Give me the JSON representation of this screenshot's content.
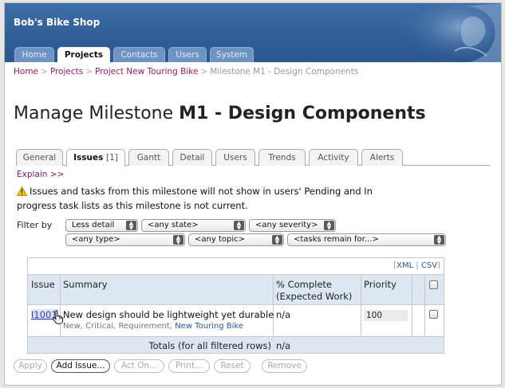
{
  "header": {
    "brand": "Bob's Bike Shop",
    "tabs": [
      {
        "label": "Home",
        "active": false
      },
      {
        "label": "Projects",
        "active": true
      },
      {
        "label": "Contacts",
        "active": false
      },
      {
        "label": "Users",
        "active": false
      },
      {
        "label": "System",
        "active": false
      }
    ]
  },
  "breadcrumb": {
    "items": [
      "Home",
      "Projects",
      "Project New Touring Bike"
    ],
    "current": "Milestone M1 - Design Components",
    "separator": ">"
  },
  "title": {
    "prefix": "Manage Milestone",
    "name": "M1 - Design Components"
  },
  "subtabs": [
    {
      "label": "General",
      "active": false
    },
    {
      "label": "Issues",
      "count": "[1]",
      "active": true
    },
    {
      "label": "Gantt",
      "active": false
    },
    {
      "label": "Detail",
      "active": false
    },
    {
      "label": "Users",
      "active": false
    },
    {
      "label": "Trends",
      "active": false
    },
    {
      "label": "Activity",
      "active": false
    },
    {
      "label": "Alerts",
      "active": false
    }
  ],
  "explain_link": "Explain >>",
  "warning": {
    "line1": "Issues and tasks from this milestone will not show in users' Pending and In",
    "line2": "progress task lists as this milestone is not current."
  },
  "filter": {
    "label": "Filter by",
    "detail": "Less detail",
    "state": "<any state>",
    "severity": "<any severity>",
    "type": "<any type>",
    "topic": "<any topic>",
    "tasks": "<tasks remain for...>"
  },
  "table": {
    "links": {
      "xml": "XML",
      "sep": "|",
      "csv": "CSV",
      "open": "[",
      "close": "]"
    },
    "columns": {
      "issue": "Issue",
      "summary": "Summary",
      "complete_1": "% Complete",
      "complete_2": "(Expected Work)",
      "priority": "Priority"
    },
    "rows": [
      {
        "id": "I1001",
        "summary": "New design should be lightweight yet durable",
        "meta": "New, Critical, Requirement,",
        "project": "New Touring Bike",
        "complete": "n/a",
        "priority": "100"
      }
    ],
    "totals": {
      "label": "Totals (for all filtered rows)",
      "value": "n/a"
    }
  },
  "buttons": {
    "apply": "Apply",
    "add_issue": "Add Issue...",
    "act_on": "Act On...",
    "print": "Print...",
    "reset": "Reset",
    "remove": "Remove"
  },
  "colors": {
    "header_blue": "#315f98",
    "link_magenta": "#9a1b5b",
    "link_blue": "#2b54a4",
    "table_header": "#dde7f1"
  }
}
